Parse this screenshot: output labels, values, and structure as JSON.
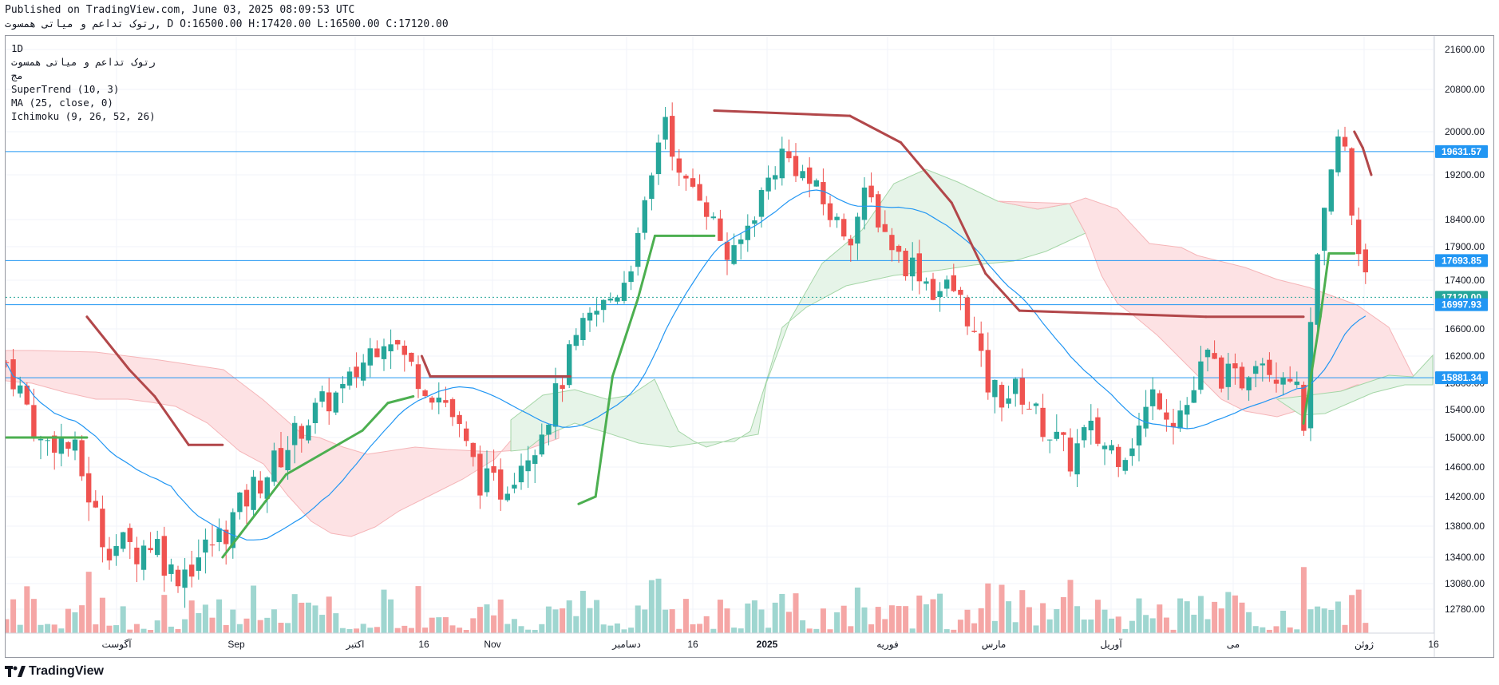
{
  "header": {
    "published_line": "Published on TradingView.com, June 03, 2025 08:09:53 UTC",
    "symbol_line": "رتوک تداعم و مياتی همسوت, D O:16500.00 H:17420.00 L:16500.00 C:17120.00"
  },
  "legend": {
    "lines": [
      "1D",
      "رتوک تداعم و مياتی همسوت",
      "مج",
      "SuperTrend (10, 3)",
      "MA (25, close, 0)",
      "Ichimoku (9, 26, 52, 26)"
    ]
  },
  "brand": {
    "name": "TradingView"
  },
  "colors": {
    "up": "#26a69a",
    "down": "#ef5350",
    "supertrend_up": "#4caf50",
    "supertrend_down": "#b2474a",
    "ma": "#2196f3",
    "cloud_bull": "#e8f5e9",
    "cloud_bear": "#fde7e9",
    "hline": "#2196f3"
  },
  "chart_data": {
    "type": "candlestick",
    "timeframe": "1D",
    "y_axis": {
      "ticks": [
        21600,
        20800,
        20000,
        19200,
        18400,
        17900,
        17400,
        16600,
        16200,
        15800,
        15400,
        15000,
        14600,
        14200,
        13800,
        13400,
        13080,
        12780
      ]
    },
    "x_axis": {
      "ticks": [
        "آگوست",
        "Sep",
        "اکتبر",
        "16",
        "Nov",
        "دسامبر",
        "16",
        "2025",
        "فوریه",
        "مارس",
        "آوریل",
        "می",
        "ژوئن",
        "16"
      ]
    },
    "horizontal_lines": [
      19631.57,
      17693.85,
      16997.93,
      15881.34
    ],
    "price_labels": [
      {
        "value": 19631.57,
        "label": "19631.57",
        "color": "#2196f3"
      },
      {
        "value": 17693.85,
        "label": "17693.85",
        "color": "#2196f3"
      },
      {
        "value": 17120.0,
        "label": "17120.00",
        "color": "#26a69a"
      },
      {
        "value": 16997.93,
        "label": "16997.93",
        "color": "#2196f3"
      },
      {
        "value": 15881.34,
        "label": "15881.34",
        "color": "#2196f3"
      }
    ],
    "last_ohlc": {
      "open": 16500.0,
      "high": 17420.0,
      "low": 16500.0,
      "close": 17120.0
    },
    "price_points": [
      {
        "d": "Jul-16",
        "p": 16100
      },
      {
        "d": "Jul-20",
        "p": 15600
      },
      {
        "d": "Jul-24",
        "p": 14900
      },
      {
        "d": "Jul-28",
        "p": 15000
      },
      {
        "d": "Aug-01",
        "p": 14800
      },
      {
        "d": "Aug-04",
        "p": 14300
      },
      {
        "d": "Aug-08",
        "p": 13600
      },
      {
        "d": "Aug-12",
        "p": 13550
      },
      {
        "d": "Aug-16",
        "p": 13500
      },
      {
        "d": "Aug-20",
        "p": 13650
      },
      {
        "d": "Aug-24",
        "p": 13200
      },
      {
        "d": "Aug-28",
        "p": 13300
      },
      {
        "d": "Sep-05",
        "p": 13700
      },
      {
        "d": "Sep-12",
        "p": 14300
      },
      {
        "d": "Sep-18",
        "p": 14700
      },
      {
        "d": "Sep-24",
        "p": 15200
      },
      {
        "d": "Sep-29",
        "p": 15500
      },
      {
        "d": "Oct-04",
        "p": 15700
      },
      {
        "d": "Oct-10",
        "p": 16300
      },
      {
        "d": "Oct-14",
        "p": 16600
      },
      {
        "d": "Oct-18",
        "p": 16150
      },
      {
        "d": "Oct-24",
        "p": 15700
      },
      {
        "d": "Oct-28",
        "p": 15500
      },
      {
        "d": "Nov-01",
        "p": 14900
      },
      {
        "d": "Nov-05",
        "p": 14400
      },
      {
        "d": "Nov-10",
        "p": 14300
      },
      {
        "d": "Nov-14",
        "p": 14700
      },
      {
        "d": "Nov-18",
        "p": 15000
      },
      {
        "d": "Nov-22",
        "p": 15500
      },
      {
        "d": "Nov-26",
        "p": 16200
      },
      {
        "d": "Nov-30",
        "p": 16700
      },
      {
        "d": "Dec-04",
        "p": 17000
      },
      {
        "d": "Dec-08",
        "p": 17300
      },
      {
        "d": "Dec-12",
        "p": 18000
      },
      {
        "d": "Dec-16",
        "p": 19400
      },
      {
        "d": "Dec-18",
        "p": 20500
      },
      {
        "d": "Dec-22",
        "p": 19000
      },
      {
        "d": "Dec-26",
        "p": 19000
      },
      {
        "d": "Dec-30",
        "p": 18300
      },
      {
        "d": "Jan-03",
        "p": 17600
      },
      {
        "d": "Jan-07",
        "p": 18300
      },
      {
        "d": "Jan-11",
        "p": 19000
      },
      {
        "d": "Jan-15",
        "p": 19600
      },
      {
        "d": "Jan-19",
        "p": 19300
      },
      {
        "d": "Jan-23",
        "p": 18900
      },
      {
        "d": "Jan-27",
        "p": 18400
      },
      {
        "d": "Jan-31",
        "p": 18100
      },
      {
        "d": "Feb-04",
        "p": 18900
      },
      {
        "d": "Feb-08",
        "p": 18200
      },
      {
        "d": "Feb-12",
        "p": 17700
      },
      {
        "d": "Feb-16",
        "p": 17600
      },
      {
        "d": "Feb-20",
        "p": 17200
      },
      {
        "d": "Feb-24",
        "p": 17300
      },
      {
        "d": "Feb-28",
        "p": 16800
      },
      {
        "d": "Mar-04",
        "p": 15800
      },
      {
        "d": "Mar-08",
        "p": 15600
      },
      {
        "d": "Mar-12",
        "p": 15700
      },
      {
        "d": "Mar-16",
        "p": 15300
      },
      {
        "d": "Mar-20",
        "p": 15000
      },
      {
        "d": "Mar-24",
        "p": 14700
      },
      {
        "d": "Mar-28",
        "p": 15100
      },
      {
        "d": "Apr-01",
        "p": 14900
      },
      {
        "d": "Apr-05",
        "p": 14800
      },
      {
        "d": "Apr-09",
        "p": 15100
      },
      {
        "d": "Apr-13",
        "p": 15700
      },
      {
        "d": "Apr-17",
        "p": 15300
      },
      {
        "d": "Apr-21",
        "p": 15500
      },
      {
        "d": "Apr-25",
        "p": 16200
      },
      {
        "d": "Apr-29",
        "p": 15900
      },
      {
        "d": "May-03",
        "p": 15800
      },
      {
        "d": "May-07",
        "p": 16300
      },
      {
        "d": "May-11",
        "p": 16000
      },
      {
        "d": "May-15",
        "p": 16000
      },
      {
        "d": "May-18",
        "p": 15200
      },
      {
        "d": "May-21",
        "p": 17500
      },
      {
        "d": "May-24",
        "p": 18900
      },
      {
        "d": "May-26",
        "p": 19900
      },
      {
        "d": "May-28",
        "p": 19600
      },
      {
        "d": "May-30",
        "p": 18000
      },
      {
        "d": "Jun-01",
        "p": 17800
      },
      {
        "d": "Jun-03",
        "p": 17120
      }
    ],
    "supertrend_points": [
      {
        "d": "Jul-16",
        "p": 15000,
        "t": "up"
      },
      {
        "d": "Aug-04",
        "p": 15000,
        "t": "up"
      },
      {
        "d": "Aug-04b",
        "p": 16800,
        "t": "down"
      },
      {
        "d": "Aug-14",
        "p": 16000,
        "t": "down"
      },
      {
        "d": "Aug-20",
        "p": 15600,
        "t": "down"
      },
      {
        "d": "Aug-28",
        "p": 14900,
        "t": "down"
      },
      {
        "d": "Sep-05",
        "p": 14900,
        "t": "down"
      },
      {
        "d": "Sep-05b",
        "p": 13400,
        "t": "up"
      },
      {
        "d": "Sep-20",
        "p": 14500,
        "t": "up"
      },
      {
        "d": "Oct-08",
        "p": 15100,
        "t": "up"
      },
      {
        "d": "Oct-14",
        "p": 15500,
        "t": "up"
      },
      {
        "d": "Oct-20",
        "p": 15600,
        "t": "up"
      },
      {
        "d": "Oct-22",
        "p": 16200,
        "t": "down"
      },
      {
        "d": "Oct-24",
        "p": 15900,
        "t": "down"
      },
      {
        "d": "Nov-26",
        "p": 15900,
        "t": "down"
      },
      {
        "d": "Nov-28",
        "p": 14100,
        "t": "up"
      },
      {
        "d": "Dec-02",
        "p": 14200,
        "t": "up"
      },
      {
        "d": "Dec-06",
        "p": 15900,
        "t": "up"
      },
      {
        "d": "Dec-12",
        "p": 17100,
        "t": "up"
      },
      {
        "d": "Dec-16",
        "p": 18100,
        "t": "up"
      },
      {
        "d": "Dec-30",
        "p": 18100,
        "t": "up"
      },
      {
        "d": "Dec-30b",
        "p": 20400,
        "t": "down"
      },
      {
        "d": "Jan-31",
        "p": 20300,
        "t": "down"
      },
      {
        "d": "Feb-12",
        "p": 19800,
        "t": "down"
      },
      {
        "d": "Feb-24",
        "p": 18700,
        "t": "down"
      },
      {
        "d": "Mar-04",
        "p": 17500,
        "t": "down"
      },
      {
        "d": "Mar-12",
        "p": 16900,
        "t": "down"
      },
      {
        "d": "Apr-25",
        "p": 16800,
        "t": "down"
      },
      {
        "d": "May-18",
        "p": 16800,
        "t": "down"
      },
      {
        "d": "May-18b",
        "p": 15200,
        "t": "up"
      },
      {
        "d": "May-22",
        "p": 16800,
        "t": "up"
      },
      {
        "d": "May-24",
        "p": 17800,
        "t": "up"
      },
      {
        "d": "May-30",
        "p": 17800,
        "t": "up"
      },
      {
        "d": "May-30b",
        "p": 20000,
        "t": "down"
      },
      {
        "d": "Jun-01",
        "p": 19700,
        "t": "down"
      },
      {
        "d": "Jun-03",
        "p": 19200,
        "t": "down"
      }
    ]
  }
}
